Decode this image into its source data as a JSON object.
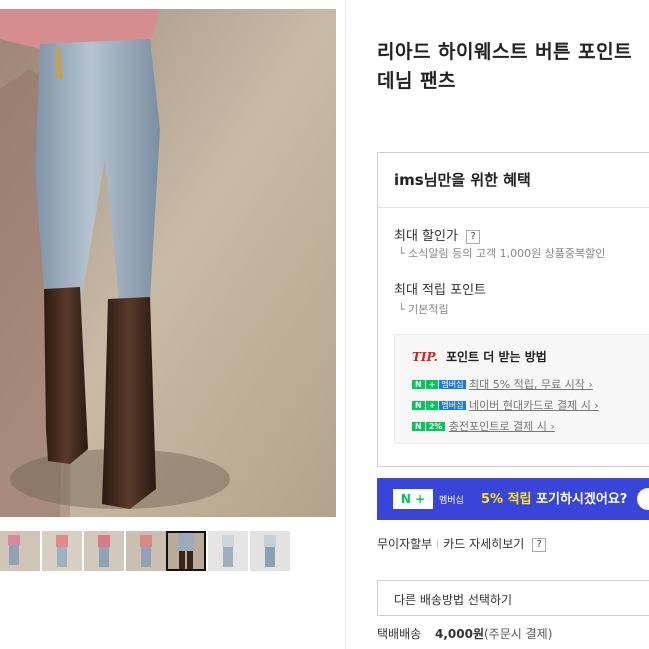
{
  "product": {
    "title_line1": "리아드 하이웨스트 버튼 포인트",
    "title_line2": "데님 팬츠"
  },
  "benefit": {
    "header": "ims님만을 위한 혜택",
    "max_discount_label": "최대 할인가",
    "max_discount_sub": "소식알림 등의 고객 1,000원 상품중복할인",
    "max_points_label": "최대 적립 포인트",
    "max_points_sub": "기본적립",
    "help_icon": "?",
    "tip": {
      "tip_word": "TIP.",
      "title": "포인트 더 받는 방법",
      "rows": [
        {
          "badge_n": "N",
          "badge_plus": "+",
          "badge_member": "멤버십",
          "text": "최대 5% 적립, 무료 시작 ›"
        },
        {
          "badge_n": "N",
          "badge_plus": "+",
          "badge_member": "멤버십",
          "text": "네이버 현대카드로 결제 시 ›"
        },
        {
          "badge_n": "N",
          "badge_pct": "2%",
          "text": "충전포인트로 결제 시 ›"
        }
      ]
    }
  },
  "banner": {
    "badge": "N +",
    "member": "멤버십",
    "highlight": "5% 적립",
    "text": " 포기하시겠어요?"
  },
  "links": {
    "installment": "무이자할부",
    "card_benefit": "카드 자세히보기",
    "help_icon": "?"
  },
  "delivery": {
    "select_label": "다른 배송방법 선택하기",
    "method": "택배배송",
    "price": "4,000원",
    "note": "(주문시 결제)"
  },
  "icons": {
    "help": "question-mark-icon",
    "chevron": "chevron-right-icon"
  },
  "colors": {
    "naver_green": "#03c75a",
    "banner_blue": "#3845d8",
    "tip_red": "#d61f1f"
  }
}
